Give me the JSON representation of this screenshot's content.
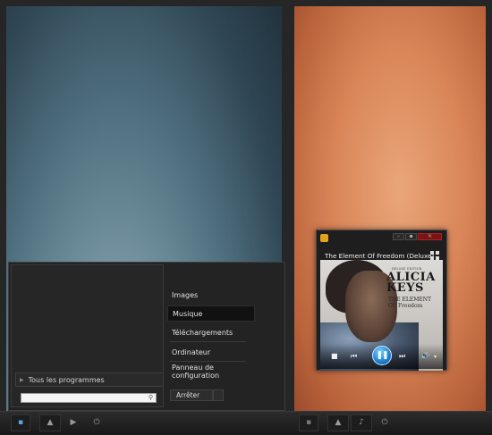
{
  "start_menu": {
    "items": [
      "Images",
      "Musique",
      "Téléchargements",
      "Ordinateur",
      "Panneau de configuration"
    ],
    "active_item": "Musique",
    "all_programs": "Tous les programmes",
    "search_placeholder": "",
    "shutdown": "Arrêter"
  },
  "media_player": {
    "title": "The Element Of Freedom (Deluxe)",
    "cover": {
      "edition": "DELUXE EDITION",
      "artist_line1": "ALICIA",
      "artist_line2": "KEYS",
      "album_line1": "THE ELEMENT",
      "album_line2": "OF Freedom"
    },
    "state": "playing"
  },
  "icons": {
    "start": "windows-orb-icon",
    "pinned_left": [
      "user-folder-icon",
      "play-icon",
      "power-icon"
    ],
    "pinned_right": [
      "user-folder-icon",
      "music-note-icon",
      "power-icon"
    ]
  },
  "colors": {
    "accent": "#1f86d8",
    "panel": "#232323"
  }
}
